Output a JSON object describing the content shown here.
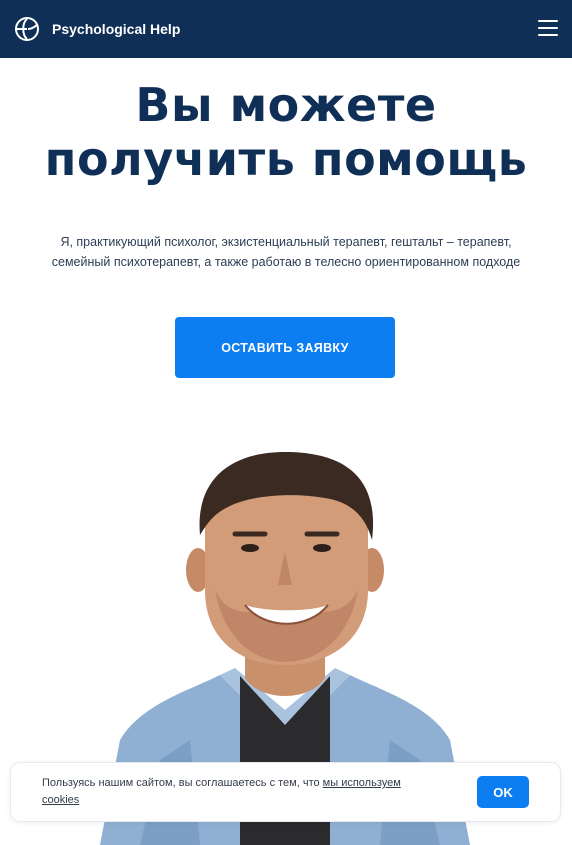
{
  "header": {
    "brand": "Psychological Help",
    "logo_icon": "brain-logo-icon",
    "menu_icon": "hamburger-menu-icon"
  },
  "hero": {
    "title_line1": "Вы можете",
    "title_line2": "получить помощь",
    "description_line1": "Я, практикующий психолог, экзистенциальный терапевт, гештальт – терапевт,",
    "description_line2": "семейный психотерапевт, а также работаю в телесно ориентированном подходе",
    "cta_label": "ОСТАВИТЬ ЗАЯВКУ"
  },
  "cookie_banner": {
    "text": "Пользуясь нашим сайтом, вы соглашаетесь с тем, что ",
    "link_text": "мы используем cookies",
    "ok_label": "OK"
  },
  "colors": {
    "header_bg": "#0f2f57",
    "title": "#0f2f57",
    "accent": "#0d7ef2"
  }
}
